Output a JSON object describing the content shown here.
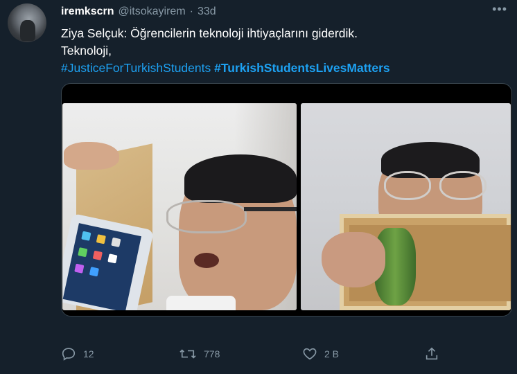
{
  "tweet": {
    "display_name": "iremkscrn",
    "handle": "@itsokayirem",
    "separator": "·",
    "time": "33d",
    "more_icon": "more-icon",
    "text_line1": "Ziya Selçuk: Öğrencilerin teknoloji ihtiyaçlarını giderdik.",
    "text_line2": "Teknoloji,",
    "hashtag1": "#JusticeForTurkishStudents",
    "hashtag2": "#TurkishStudentsLivesMatters"
  },
  "actions": {
    "reply": {
      "icon": "reply-icon",
      "count": "12"
    },
    "retweet": {
      "icon": "retweet-icon",
      "count": "778"
    },
    "like": {
      "icon": "heart-icon",
      "count": "2 B"
    },
    "share": {
      "icon": "share-icon"
    }
  },
  "colors": {
    "background": "#15202b",
    "secondary_text": "#8899a6",
    "link": "#1da1f2",
    "border": "#38444d"
  }
}
